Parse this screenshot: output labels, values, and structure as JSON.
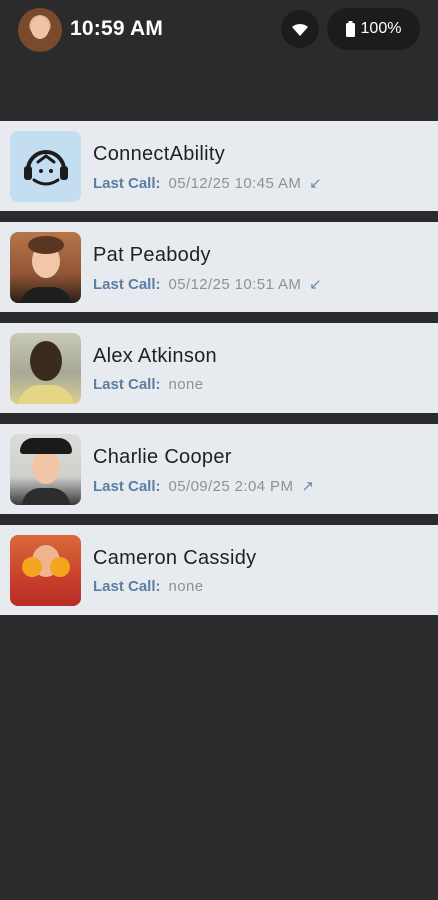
{
  "status_bar": {
    "time": "10:59 AM",
    "battery": "100%",
    "wifi_icon": "wifi-icon",
    "battery_icon": "battery-icon"
  },
  "contacts": [
    {
      "name": "ConnectAbility",
      "last_call_label": "Last Call:",
      "last_call": "05/12/25  10:45 AM",
      "direction": "incoming",
      "arrow": "↙",
      "photo_icon": "headset-icon"
    },
    {
      "name": "Pat Peabody",
      "last_call_label": "Last Call:",
      "last_call": "05/12/25  10:51 AM",
      "direction": "incoming",
      "arrow": "↙"
    },
    {
      "name": "Alex Atkinson",
      "last_call_label": "Last Call:",
      "last_call": "none",
      "direction": "",
      "arrow": ""
    },
    {
      "name": "Charlie Cooper",
      "last_call_label": "Last Call:",
      "last_call": "05/09/25  2:04 PM",
      "direction": "outgoing",
      "arrow": "↗"
    },
    {
      "name": "Cameron Cassidy",
      "last_call_label": "Last Call:",
      "last_call": "none",
      "direction": "",
      "arrow": ""
    }
  ],
  "colors": {
    "background": "#2b2b2d",
    "card": "#e7ebef",
    "label": "#5b7ea3",
    "value": "#8e9197"
  }
}
